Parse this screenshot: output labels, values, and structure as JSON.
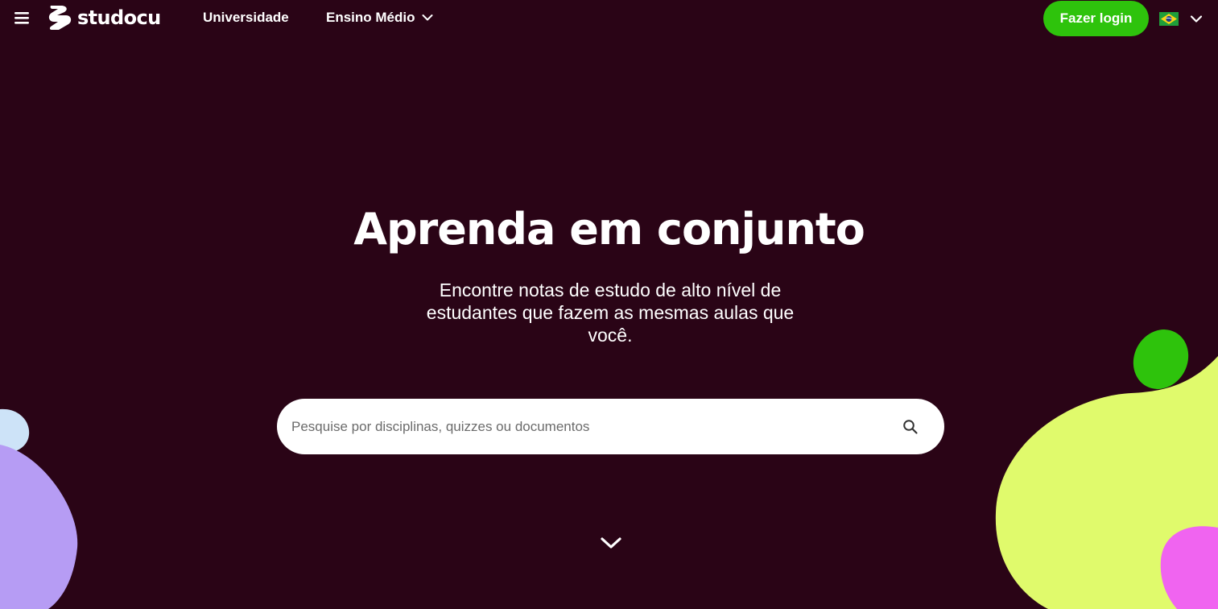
{
  "header": {
    "brand": "studocu",
    "nav": {
      "university": "Universidade",
      "high_school": "Ensino Médio"
    },
    "login_label": "Fazer login",
    "language_flag": "brazil-flag-icon"
  },
  "hero": {
    "title": "Aprenda em conjunto",
    "subtitle": "Encontre notas de estudo de alto nível de estudantes que fazem as mesmas aulas que você."
  },
  "search": {
    "placeholder": "Pesquise por disciplinas, quizzes ou documentos",
    "value": ""
  },
  "icons": {
    "menu": "hamburger-menu-icon",
    "search": "search-icon",
    "scroll": "chevron-down-icon"
  },
  "colors": {
    "background": "#2a0416",
    "accent_green": "#2ec30c",
    "blob_lime": "#e0fa6c",
    "blob_purple": "#b69cf4",
    "blob_pink": "#f064f0",
    "blob_lightblue": "#cde3f8"
  }
}
